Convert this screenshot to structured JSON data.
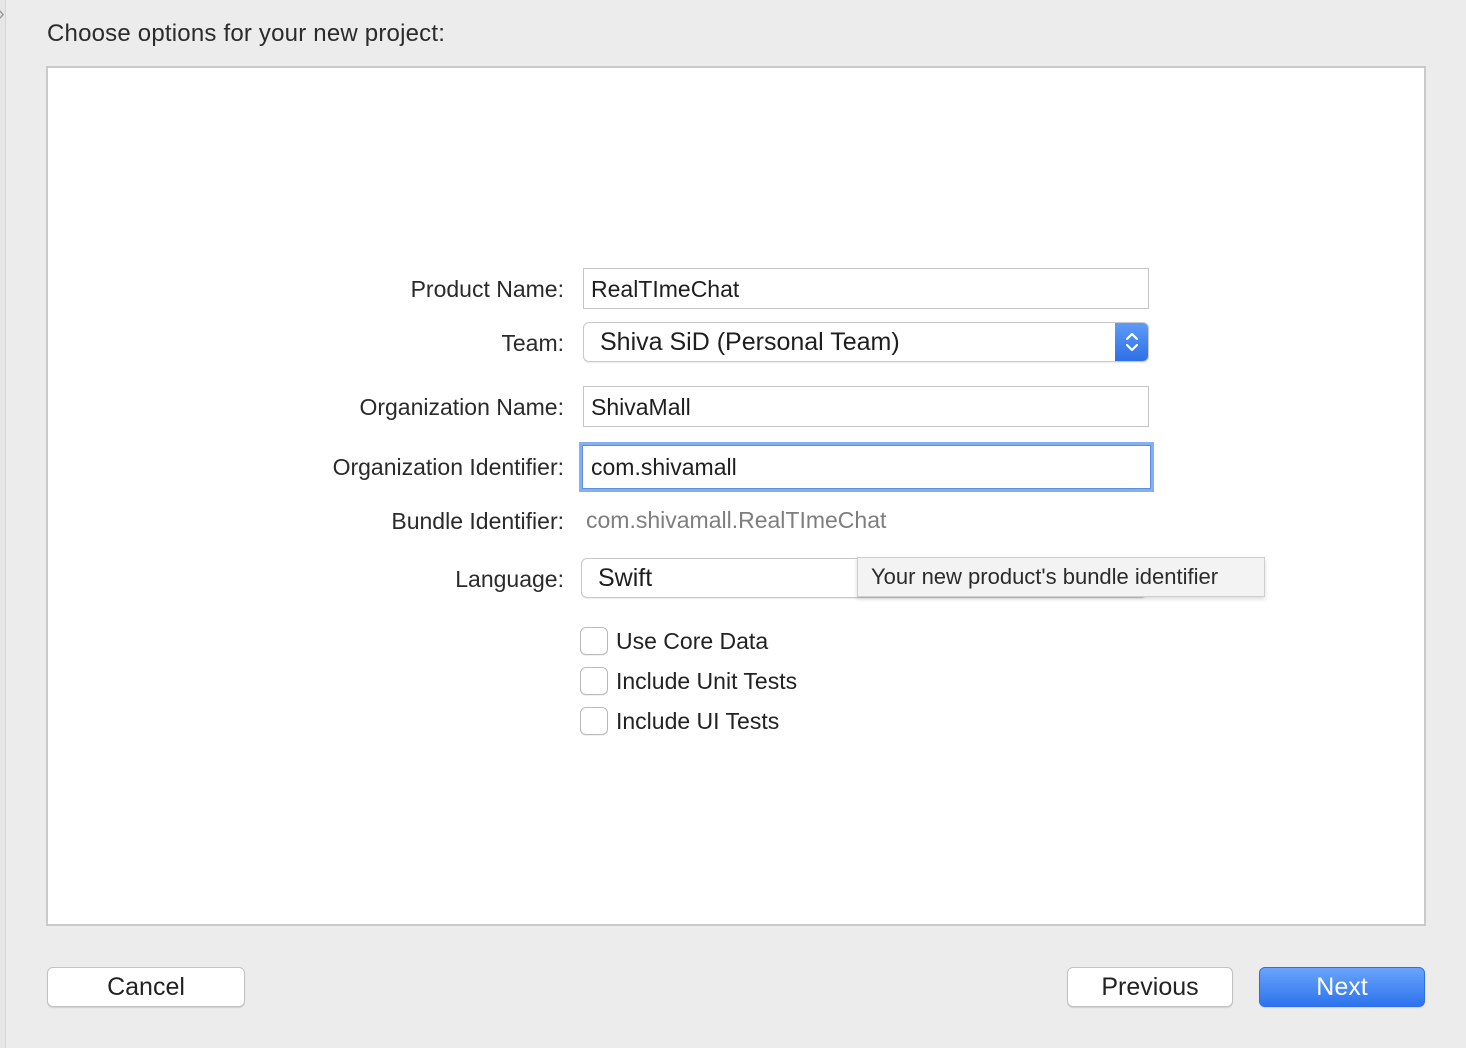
{
  "dialog": {
    "heading": "Choose options for your new project:"
  },
  "form": {
    "product_name": {
      "label": "Product Name:",
      "value": "RealTImeChat"
    },
    "team": {
      "label": "Team:",
      "value": "Shiva SiD (Personal Team)"
    },
    "organization_name": {
      "label": "Organization Name:",
      "value": "ShivaMall"
    },
    "organization_identifier": {
      "label": "Organization Identifier:",
      "value": "com.shivamall"
    },
    "bundle_identifier": {
      "label": "Bundle Identifier:",
      "value": "com.shivamall.RealTImeChat"
    },
    "language": {
      "label": "Language:",
      "value": "Swift"
    },
    "checkboxes": [
      {
        "label": "Use Core Data",
        "checked": false
      },
      {
        "label": "Include Unit Tests",
        "checked": false
      },
      {
        "label": "Include UI Tests",
        "checked": false
      }
    ]
  },
  "tooltip": {
    "text": "Your new product's bundle identifier"
  },
  "buttons": {
    "cancel": "Cancel",
    "previous": "Previous",
    "next": "Next"
  },
  "colors": {
    "accent": "#2d73ee",
    "focus_ring": "#86aff0"
  }
}
